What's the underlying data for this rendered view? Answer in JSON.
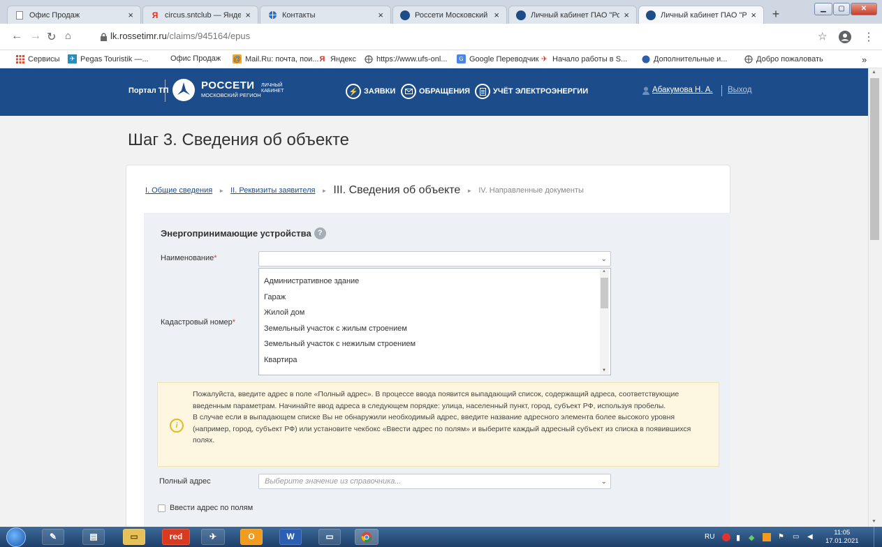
{
  "browser": {
    "tabs": [
      {
        "label": "Офис Продаж",
        "icon": "document-icon",
        "active": false
      },
      {
        "label": "circus.sntclub — Яндекс: н",
        "icon": "yandex-icon",
        "active": false
      },
      {
        "label": "Контакты",
        "icon": "globe-icon",
        "active": false
      },
      {
        "label": "Россети Московский рег",
        "icon": "rosseti-icon",
        "active": false
      },
      {
        "label": "Личный кабинет ПАО \"Ро",
        "icon": "rosseti-icon",
        "active": false
      },
      {
        "label": "Личный кабинет ПАО \"Ро",
        "icon": "rosseti-icon",
        "active": true
      }
    ],
    "new_tab": "+",
    "address": {
      "host": "lk.rossetimr.ru",
      "path": "/claims/945164/epus"
    },
    "bookmarks": [
      {
        "label": "Сервисы",
        "icon": "apps-grid-icon"
      },
      {
        "label": "Pegas Touristik —...",
        "icon": "pegas-icon"
      },
      {
        "label": "Офис Продаж",
        "icon": "none"
      },
      {
        "label": "Mail.Ru: почта, пои...",
        "icon": "mail-icon"
      },
      {
        "label": "Яндекс",
        "icon": "yandex-icon"
      },
      {
        "label": "https://www.ufs-onl...",
        "icon": "globe-icon"
      },
      {
        "label": "Google Переводчик",
        "icon": "translate-icon"
      },
      {
        "label": "Начало работы в S...",
        "icon": "plane-icon"
      },
      {
        "label": "Дополнительные и...",
        "icon": "extension-icon"
      },
      {
        "label": "Добро пожаловать",
        "icon": "globe-icon"
      }
    ],
    "bookmarks_more": "»"
  },
  "header": {
    "portal": "Портал ТП",
    "brand": "РОССЕТИ",
    "brand_sub": "МОСКОВСКИЙ РЕГИОН",
    "cabinet_line1": "ЛИЧНЫЙ",
    "cabinet_line2": "КАБИНЕТ",
    "nav": [
      {
        "label": "ЗАЯВКИ",
        "icon": "lightning-icon"
      },
      {
        "label": "ОБРАЩЕНИЯ",
        "icon": "envelope-icon"
      },
      {
        "label": "УЧЁТ ЭЛЕКТРОЭНЕРГИИ",
        "icon": "document-icon"
      }
    ],
    "user": "Абакумова Н. А.",
    "logout": "Выход"
  },
  "page": {
    "title": "Шаг 3. Сведения об объекте",
    "breadcrumb": [
      {
        "label": "I. Общие сведения",
        "state": "link"
      },
      {
        "label": "II. Реквизиты заявителя",
        "state": "link"
      },
      {
        "label": "III. Сведения об объекте",
        "state": "current"
      },
      {
        "label": "IV. Направленные документы",
        "state": "disabled"
      }
    ],
    "section_title": "Энергопринимающие устройства",
    "help_glyph": "?",
    "name_label": "Наименование",
    "cadastral_label": "Кадастровый номер",
    "required_mark": "*",
    "dropdown_options": [
      "Административное здание",
      "Гараж",
      "Жилой дом",
      "Земельный участок с жилым строением",
      "Земельный участок с нежилым строением",
      "Квартира"
    ],
    "info": {
      "icon_glyph": "i",
      "paragraph1": "Пожалуйста, введите адрес в поле «Полный адрес». В процессе ввода появится выпадающий список, содержащий адреса, соответствующие введенным параметрам. Начинайте ввод адреса в следующем порядке: улица, населенный пункт, город, субъект РФ, используя пробелы.",
      "paragraph2": "В случае если в выпадающем списке Вы не обнаружили необходимый адрес, введите название адресного элемента более высокого уровня (например, город, субъект РФ) или установите чекбокс «Ввести адрес по полям» и выберите каждый адресный субъект из списка в появившихся полях."
    },
    "address_label": "Полный адрес",
    "address_placeholder": "Выберите значение из справочника...",
    "checkbox_label": "Ввести адрес по полям"
  },
  "taskbar": {
    "apps": [
      {
        "label": "",
        "icon": "paint-icon"
      },
      {
        "label": "",
        "icon": "notepad-icon"
      },
      {
        "label": "",
        "icon": "folder-icon"
      },
      {
        "label": "red",
        "icon": "red-app-icon"
      },
      {
        "label": "",
        "icon": "plane-icon"
      },
      {
        "label": "",
        "icon": "outlook-icon"
      },
      {
        "label": "W",
        "icon": "word-icon"
      },
      {
        "label": "",
        "icon": "window-icon"
      },
      {
        "label": "",
        "icon": "chrome-icon"
      }
    ],
    "language": "RU",
    "time": "11:05",
    "date": "17.01.2021"
  },
  "colors": {
    "header_bg": "#1c4c8a",
    "link": "#1c4c8a",
    "required": "#d04040",
    "info_bg": "#fdf7e1",
    "info_icon": "#e5b922"
  }
}
